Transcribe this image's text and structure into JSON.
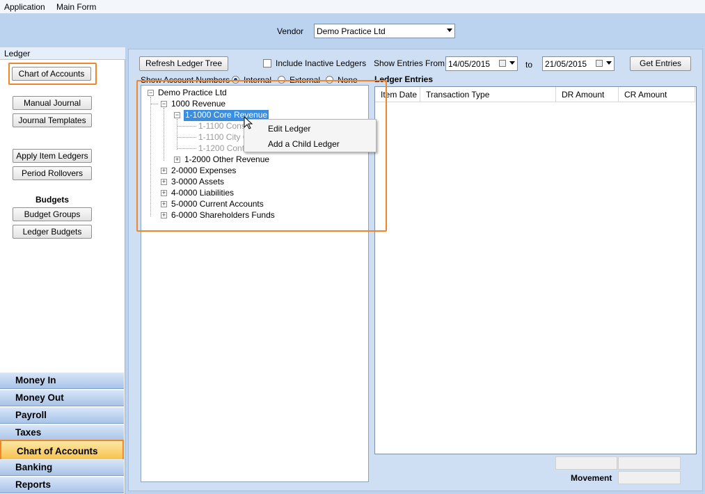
{
  "menubar": {
    "items": [
      "Application",
      "Main Form"
    ]
  },
  "vendor": {
    "label": "Vendor",
    "value": "Demo Practice Ltd"
  },
  "sidebar": {
    "header": "Ledger",
    "buttons": [
      "Chart of Accounts",
      "Manual Journal",
      "Journal Templates",
      "Apply Item Ledgers",
      "Period Rollovers"
    ],
    "budgets_title": "Budgets",
    "budget_buttons": [
      "Budget Groups",
      "Ledger Budgets"
    ],
    "nav": [
      "Money In",
      "Money Out",
      "Payroll",
      "Taxes",
      "Chart of Accounts",
      "Banking",
      "Reports"
    ],
    "active_nav": "Chart of Accounts"
  },
  "toolbar": {
    "refresh_label": "Refresh Ledger Tree",
    "include_inactive_label": "Include Inactive Ledgers",
    "show_entries_label": "Show Entries From",
    "date_from": "14/05/2015",
    "to_label": "to",
    "date_to": "21/05/2015",
    "get_entries_label": "Get Entries",
    "show_numbers_label": "Show Account Numbers",
    "radio_options": [
      "Internal",
      "External",
      "None"
    ],
    "radio_selected": "Internal"
  },
  "tree": {
    "root": "Demo Practice Ltd",
    "nodes": [
      "1000 Revenue",
      "1-1000 Core Revenue",
      "1-1100 Consu",
      "1-1100  City C",
      "1-1200 Contra",
      "1-2000 Other Revenue",
      "2-0000 Expenses",
      "3-0000 Assets",
      "4-0000 Liabilities",
      "5-0000 Current Accounts",
      "6-0000 Shareholders Funds"
    ],
    "selected": "1-1000 Core Revenue"
  },
  "context_menu": {
    "items": [
      "Edit Ledger",
      "Add a Child Ledger"
    ]
  },
  "entries": {
    "title": "Ledger Entries",
    "columns": [
      "Item Date",
      "Transaction Type",
      "DR Amount",
      "CR Amount"
    ],
    "rows": [],
    "movement_label": "Movement"
  },
  "colors": {
    "highlight": "#f0862a",
    "selection": "#3a8ddf",
    "active_nav": "#f7bf4a"
  }
}
